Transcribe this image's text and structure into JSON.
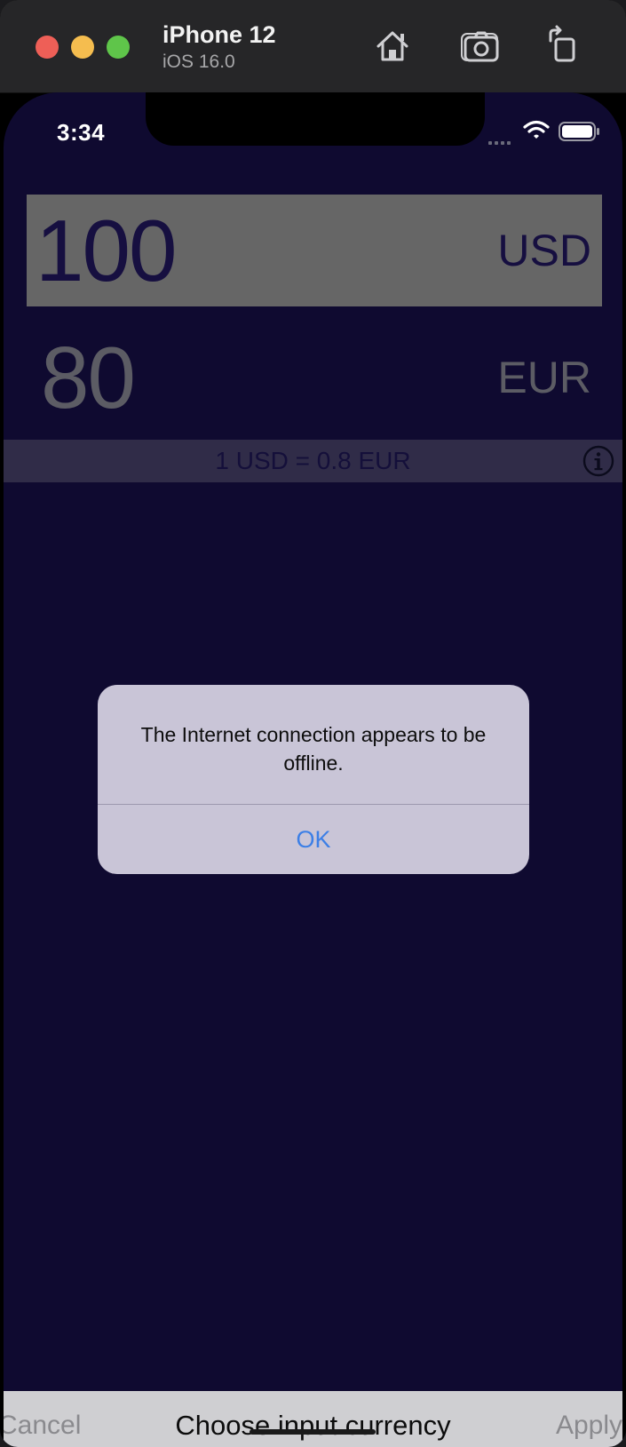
{
  "simulator": {
    "device_name": "iPhone 12",
    "os_version": "iOS 16.0",
    "toolbar_icons": [
      "home-icon",
      "screenshot-icon",
      "rotate-icon"
    ]
  },
  "status_bar": {
    "time": "3:34",
    "icons": [
      "cellular-icon",
      "wifi-icon",
      "battery-icon"
    ]
  },
  "converter": {
    "input_amount": "100",
    "input_currency": "USD",
    "output_amount": "80",
    "output_currency": "EUR",
    "rate_text": "1 USD = 0.8 EUR",
    "info_icon": "info-icon"
  },
  "alert": {
    "message": "The Internet connection appears to be offline.",
    "ok_label": "OK"
  },
  "picker_toolbar": {
    "cancel_label": "Cancel",
    "title": "Choose input currency",
    "apply_label": "Apply"
  },
  "colors": {
    "background": "#0f0a30",
    "input_row": "#666666",
    "rate_bar": "#302c48",
    "alert_background": "#c9c5d7",
    "alert_button": "#3c7fe6"
  }
}
